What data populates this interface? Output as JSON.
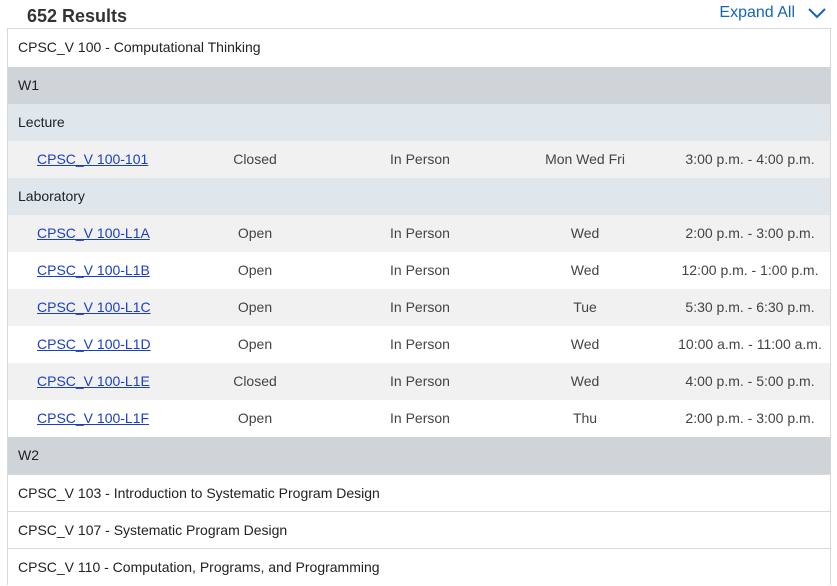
{
  "header": {
    "results": "652 Results",
    "expand_label": "Expand All"
  },
  "icons": {
    "expand": "chevron-down-icon"
  },
  "colors": {
    "link": "#1a3fc4",
    "accent": "#1565c0",
    "term_bg": "#cfd4d8",
    "type_bg": "#dfe6ec"
  },
  "courses": [
    "CPSC_V 100 - Computational Thinking",
    "CPSC_V 103 - Introduction to Systematic Program Design",
    "CPSC_V 107 - Systematic Program Design",
    "CPSC_V 110 - Computation, Programs, and Programming"
  ],
  "terms": [
    "W1",
    "W2"
  ],
  "types": [
    "Lecture",
    "Laboratory"
  ],
  "sections": [
    {
      "code": "CPSC_V 100-101",
      "status": "Closed",
      "mode": "In Person",
      "days": "Mon Wed Fri",
      "time": "3:00 p.m. - 4:00 p.m."
    },
    {
      "code": "CPSC_V 100-L1A",
      "status": "Open",
      "mode": "In Person",
      "days": "Wed",
      "time": "2:00 p.m. - 3:00 p.m."
    },
    {
      "code": "CPSC_V 100-L1B",
      "status": "Open",
      "mode": "In Person",
      "days": "Wed",
      "time": "12:00 p.m. - 1:00 p.m."
    },
    {
      "code": "CPSC_V 100-L1C",
      "status": "Open",
      "mode": "In Person",
      "days": "Tue",
      "time": "5:30 p.m. - 6:30 p.m."
    },
    {
      "code": "CPSC_V 100-L1D",
      "status": "Open",
      "mode": "In Person",
      "days": "Wed",
      "time": "10:00 a.m. - 11:00 a.m."
    },
    {
      "code": "CPSC_V 100-L1E",
      "status": "Closed",
      "mode": "In Person",
      "days": "Wed",
      "time": "4:00 p.m. - 5:00 p.m."
    },
    {
      "code": "CPSC_V 100-L1F",
      "status": "Open",
      "mode": "In Person",
      "days": "Thu",
      "time": "2:00 p.m. - 3:00 p.m."
    }
  ]
}
